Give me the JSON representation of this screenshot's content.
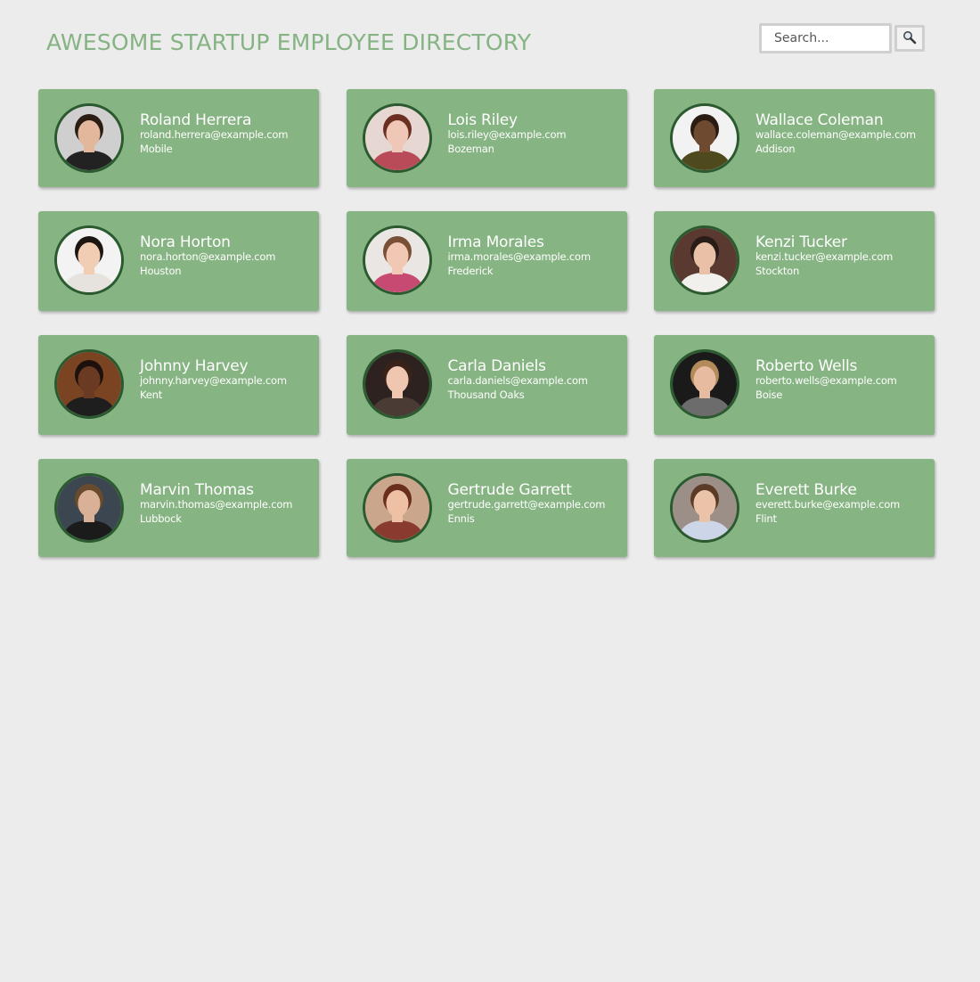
{
  "header": {
    "title": "AWESOME STARTUP EMPLOYEE DIRECTORY"
  },
  "search": {
    "placeholder": "Search...",
    "button_icon": "magnifier-icon"
  },
  "colors": {
    "background": "#ececec",
    "title": "#86b383",
    "card": "#87b483",
    "avatar_ring": "#2c5a30",
    "card_text": "#ffffff"
  },
  "employees": [
    {
      "name": "Roland Herrera",
      "email": "roland.herrera@example.com",
      "city": "Mobile",
      "skin": "#e3b79c",
      "hair": "#2b1c14",
      "bg": "#cfcfcf",
      "shirt": "#222222"
    },
    {
      "name": "Lois Riley",
      "email": "lois.riley@example.com",
      "city": "Bozeman",
      "skin": "#efc7b6",
      "hair": "#6b2f22",
      "bg": "#e7d7d2",
      "shirt": "#b84b57"
    },
    {
      "name": "Wallace Coleman",
      "email": "wallace.coleman@example.com",
      "city": "Addison",
      "skin": "#6e4a30",
      "hair": "#2a1c13",
      "bg": "#f2f2f2",
      "shirt": "#4f4a1e"
    },
    {
      "name": "Nora Horton",
      "email": "nora.horton@example.com",
      "city": "Houston",
      "skin": "#f1cdb3",
      "hair": "#1e1612",
      "bg": "#f3f3f3",
      "shirt": "#e6e3df"
    },
    {
      "name": "Irma Morales",
      "email": "irma.morales@example.com",
      "city": "Frederick",
      "skin": "#f0c8b3",
      "hair": "#7a4f35",
      "bg": "#e9e6e3",
      "shirt": "#c74a72"
    },
    {
      "name": "Kenzi Tucker",
      "email": "kenzi.tucker@example.com",
      "city": "Stockton",
      "skin": "#e8c1a6",
      "hair": "#2a1c17",
      "bg": "#5a3a30",
      "shirt": "#f2f0ed"
    },
    {
      "name": "Johnny Harvey",
      "email": "johnny.harvey@example.com",
      "city": "Kent",
      "skin": "#6b3a22",
      "hair": "#1c110c",
      "bg": "#7a4422",
      "shirt": "#1e1e1e"
    },
    {
      "name": "Carla Daniels",
      "email": "carla.daniels@example.com",
      "city": "Thousand Oaks",
      "skin": "#efc6b0",
      "hair": "#3a2218",
      "bg": "#2d2220",
      "shirt": "#4a3b35"
    },
    {
      "name": "Roberto Wells",
      "email": "roberto.wells@example.com",
      "city": "Boise",
      "skin": "#e6bb9f",
      "hair": "#b38a5a",
      "bg": "#1a1a1a",
      "shirt": "#6c6c6c"
    },
    {
      "name": "Marvin Thomas",
      "email": "marvin.thomas@example.com",
      "city": "Lubbock",
      "skin": "#d9b196",
      "hair": "#6a4a2c",
      "bg": "#3c4650",
      "shirt": "#1b1b1b"
    },
    {
      "name": "Gertrude Garrett",
      "email": "gertrude.garrett@example.com",
      "city": "Ennis",
      "skin": "#eec0a4",
      "hair": "#6a2e1c",
      "bg": "#c9a68c",
      "shirt": "#8a3b30"
    },
    {
      "name": "Everett Burke",
      "email": "everett.burke@example.com",
      "city": "Flint",
      "skin": "#ebc3a8",
      "hair": "#5c3b26",
      "bg": "#9b8f87",
      "shirt": "#cdd6e8"
    }
  ]
}
